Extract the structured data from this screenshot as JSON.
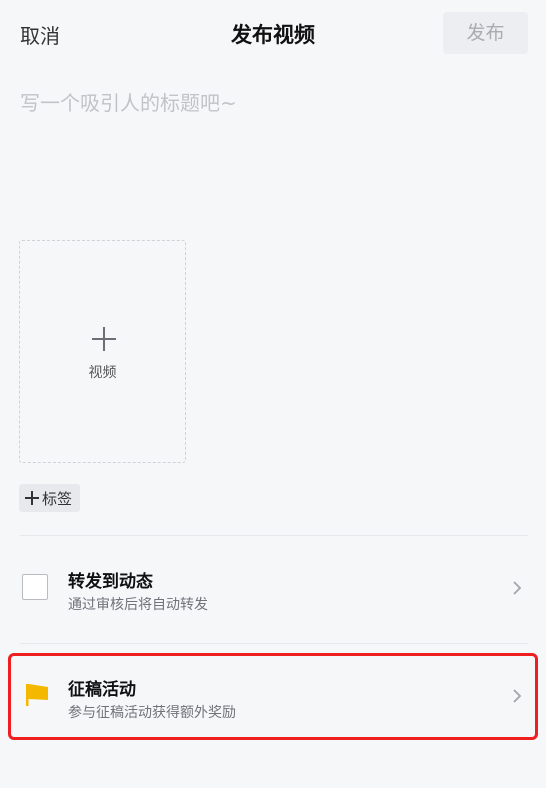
{
  "header": {
    "cancel_label": "取消",
    "title": "发布视频",
    "publish_label": "发布"
  },
  "title_input": {
    "placeholder": "写一个吸引人的标题吧~",
    "value": ""
  },
  "video_upload": {
    "label": "视频"
  },
  "tag_button": {
    "label": "标签"
  },
  "options": {
    "repost": {
      "title": "转发到动态",
      "subtitle": "通过审核后将自动转发",
      "checked": false
    },
    "campaign": {
      "title": "征稿活动",
      "subtitle": "参与征稿活动获得额外奖励"
    }
  },
  "colors": {
    "accent_highlight": "#ef1f1f",
    "flag": "#f5b800",
    "disabled_text": "#a9adb3"
  }
}
